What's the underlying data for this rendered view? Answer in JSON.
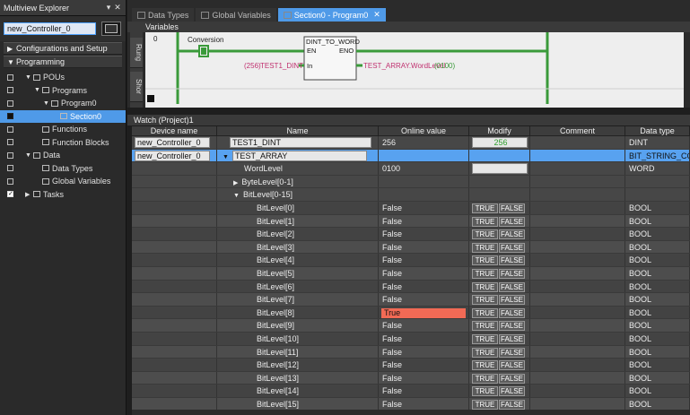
{
  "left": {
    "title": "Multiview Explorer",
    "pin": "▾",
    "close": "✕",
    "controller": "new_Controller_0",
    "sections": [
      {
        "label": "Configurations and Setup",
        "arrow": "▶"
      },
      {
        "label": "Programming",
        "arrow": "▼"
      }
    ],
    "tree": [
      {
        "label": "POUs",
        "exp": "▼",
        "indent": 1
      },
      {
        "label": "Programs",
        "exp": "▼",
        "indent": 2
      },
      {
        "label": "Program0",
        "exp": "▼",
        "indent": 3
      },
      {
        "label": "Section0",
        "exp": "",
        "indent": 4
      },
      {
        "label": "Functions",
        "exp": "",
        "indent": 2
      },
      {
        "label": "Function Blocks",
        "exp": "",
        "indent": 2
      },
      {
        "label": "Data",
        "exp": "▼",
        "indent": 1
      },
      {
        "label": "Data Types",
        "exp": "",
        "indent": 2
      },
      {
        "label": "Global Variables",
        "exp": "",
        "indent": 2
      },
      {
        "label": "Tasks",
        "exp": "▶",
        "indent": 1
      }
    ]
  },
  "tabs": [
    {
      "label": "Data Types"
    },
    {
      "label": "Global Variables"
    },
    {
      "label": "Section0 - Program0",
      "close": "✕"
    }
  ],
  "variables_label": "Variables",
  "ladder": {
    "rung": "0",
    "side_tabs": [
      "Rung",
      "Shor"
    ],
    "contact": "Conversion",
    "fb_name": "DINT_TO_WORD",
    "pin_en": "EN",
    "pin_eno": "ENO",
    "pin_in": "In",
    "in_value": "(256)",
    "in_var": "TEST1_DINT",
    "out_var": "TEST_ARRAY.WordLevel",
    "out_value": "(0100)"
  },
  "watch": {
    "title": "Watch (Project)1",
    "headers": [
      "Device name",
      "Name",
      "Online value",
      "Modify",
      "Comment",
      "Data type"
    ],
    "rows": [
      {
        "device": "new_Controller_0",
        "name": "TEST1_DINT",
        "online": "256",
        "modify": "256",
        "type": "DINT"
      },
      {
        "device": "new_Controller_0",
        "name": "TEST_ARRAY",
        "online": "",
        "modify": "",
        "type": "BIT_STRING_CON"
      },
      {
        "device": "",
        "name": "WordLevel",
        "online": "0100",
        "modify": "",
        "type": "WORD"
      },
      {
        "device": "",
        "name": "ByteLevel[0-1]",
        "online": "",
        "modify": "",
        "type": ""
      },
      {
        "device": "",
        "name": "BitLevel[0-15]",
        "online": "",
        "modify": "",
        "type": ""
      },
      {
        "device": "",
        "name": "BitLevel[0]",
        "online": "False",
        "modify": "buttons",
        "type": "BOOL"
      },
      {
        "device": "",
        "name": "BitLevel[1]",
        "online": "False",
        "modify": "buttons",
        "type": "BOOL"
      },
      {
        "device": "",
        "name": "BitLevel[2]",
        "online": "False",
        "modify": "buttons",
        "type": "BOOL"
      },
      {
        "device": "",
        "name": "BitLevel[3]",
        "online": "False",
        "modify": "buttons",
        "type": "BOOL"
      },
      {
        "device": "",
        "name": "BitLevel[4]",
        "online": "False",
        "modify": "buttons",
        "type": "BOOL"
      },
      {
        "device": "",
        "name": "BitLevel[5]",
        "online": "False",
        "modify": "buttons",
        "type": "BOOL"
      },
      {
        "device": "",
        "name": "BitLevel[6]",
        "online": "False",
        "modify": "buttons",
        "type": "BOOL"
      },
      {
        "device": "",
        "name": "BitLevel[7]",
        "online": "False",
        "modify": "buttons",
        "type": "BOOL"
      },
      {
        "device": "",
        "name": "BitLevel[8]",
        "online": "True",
        "modify": "buttons",
        "type": "BOOL"
      },
      {
        "device": "",
        "name": "BitLevel[9]",
        "online": "False",
        "modify": "buttons",
        "type": "BOOL"
      },
      {
        "device": "",
        "name": "BitLevel[10]",
        "online": "False",
        "modify": "buttons",
        "type": "BOOL"
      },
      {
        "device": "",
        "name": "BitLevel[11]",
        "online": "False",
        "modify": "buttons",
        "type": "BOOL"
      },
      {
        "device": "",
        "name": "BitLevel[12]",
        "online": "False",
        "modify": "buttons",
        "type": "BOOL"
      },
      {
        "device": "",
        "name": "BitLevel[13]",
        "online": "False",
        "modify": "buttons",
        "type": "BOOL"
      },
      {
        "device": "",
        "name": "BitLevel[14]",
        "online": "False",
        "modify": "buttons",
        "type": "BOOL"
      },
      {
        "device": "",
        "name": "BitLevel[15]",
        "online": "False",
        "modify": "buttons",
        "type": "BOOL"
      }
    ],
    "btn_true": "TRUE",
    "btn_false": "FALSE"
  },
  "colors": {
    "accent": "#4f9ae8",
    "rung": "#3a9a3a",
    "true_cell": "#f26a55",
    "variable": "#c0306f"
  }
}
